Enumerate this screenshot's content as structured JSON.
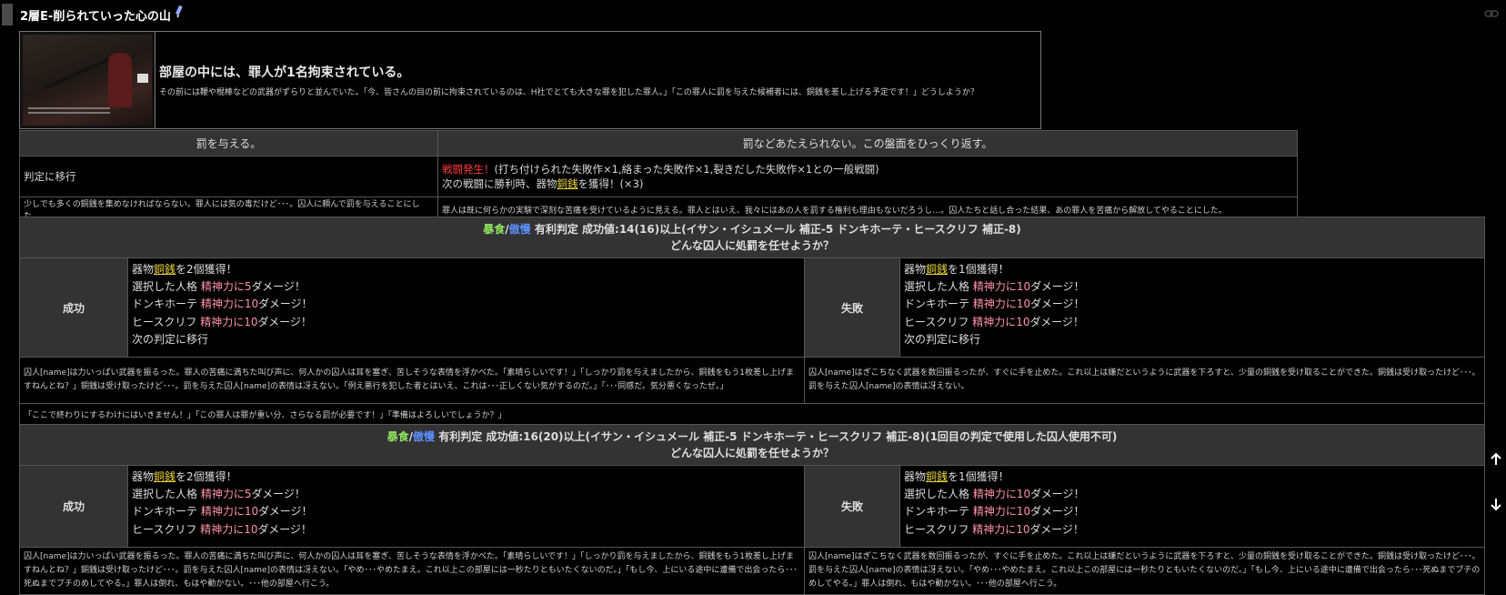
{
  "title": "2層E-削られていった心の山",
  "intro": {
    "heading": "部屋の中には、罪人が1名拘束されている。",
    "body": "その前には鞭や棍棒などの武器がずらりと並んでいた。「今、皆さんの目の前に拘束されているのは、H社でとても大きな罪を犯した罪人。」「この罪人に罰を与えた候補者には、銅銭を差し上げる予定です！」どうしようか？"
  },
  "choices": {
    "option_a": "罰を与える。",
    "option_b": "罰などあたえられない。この盤面をひっくり返す。",
    "a_effect": "判定に移行",
    "b_battle": "戦闘発生！",
    "b_battle_detail": "(打ち付けられた失敗作×1,絡まった失敗作×1,裂きだした失敗作×1との一般戦闘)",
    "b_reward_prefix": "次の戦闘に勝利時、器物",
    "b_reward_coin": "銅銭",
    "b_reward_suffix": "を獲得！(×3)",
    "a_desc": "少しでも多くの銅銭を集めなければならない。罪人には気の毒だけど･･･。囚人に頼んで罰を与えることにした。",
    "b_desc": "罪人は既に何らかの実験で深刻な苦痛を受けているように見える。罪人とはいえ、我々にはあの人を罰する権利も理由もないだろうし…。囚人たちと話し合った結果、あの罪人を苦痛から解放してやることにした。"
  },
  "judge1": {
    "stat1": "暴食",
    "slash": "/",
    "stat2": "傲慢",
    "condition": "有利判定 成功値:14(16)以上(イサン・イシュメール 補正-5 ドンキホーテ・ヒースクリフ 補正-8)",
    "question": "どんな囚人に処罰を任せようか？",
    "success_label": "成功",
    "fail_label": "失敗",
    "success": {
      "l1_a": "器物",
      "l1_coin": "銅銭",
      "l1_b": "を2個獲得！",
      "l2_name": "選択した人格 ",
      "l2_dmg": "精神力に5",
      "l2_tail": "ダメージ！",
      "l3_name": "ドンキホーテ ",
      "l3_dmg": "精神力に10",
      "l3_tail": "ダメージ！",
      "l4_name": "ヒースクリフ ",
      "l4_dmg": "精神力に10",
      "l4_tail": "ダメージ！",
      "l5": "次の判定に移行"
    },
    "fail": {
      "l1_a": "器物",
      "l1_coin": "銅銭",
      "l1_b": "を1個獲得！",
      "l2_name": "選択した人格 ",
      "l2_dmg": "精神力に10",
      "l2_tail": "ダメージ！",
      "l3_name": "ドンキホーテ ",
      "l3_dmg": "精神力に10",
      "l3_tail": "ダメージ！",
      "l4_name": "ヒースクリフ ",
      "l4_dmg": "精神力に10",
      "l4_tail": "ダメージ！",
      "l5": "次の判定に移行"
    },
    "success_desc": "囚人[name]は力いっぱい武器を振るった。罪人の苦痛に満ちた叫び声に、何人かの囚人は耳を塞ぎ、苦しそうな表情を浮かべた。「素晴らしいです！」「しっかり罰を与えましたから、銅銭をもう1枚差し上げますねんとね？」銅銭は受け取ったけど･･･。罰を与えた囚人[name]の表情は冴えない。「例え悪行を犯した者とはいえ、これは･･･正しくない気がするのだ。」「･･･同感だ。気分悪くなったぜ。」",
    "fail_desc": "囚人[name]はぎこちなく武器を数回振るったが、すぐに手を止めた。これ以上は嫌だというように武器を下ろすと、少量の銅銭を受け取ることができた。銅銭は受け取ったけど･･･。罰を与えた囚人[name]の表情は冴えない。",
    "quote": "「ここで終わりにするわけにはいきません！」「この罪人は罪が重い分、さらなる罰が必要です！」「準備はよろしいでしょうか？」"
  },
  "judge2": {
    "stat1": "暴食",
    "slash": "/",
    "stat2": "傲慢",
    "condition": "有利判定 成功値:16(20)以上(イサン・イシュメール 補正-5 ドンキホーテ・ヒースクリフ 補正-8)(1回目の判定で使用した囚人使用不可)",
    "question": "どんな囚人に処罰を任せようか？",
    "success_label": "成功",
    "fail_label": "失敗",
    "success": {
      "l1_a": "器物",
      "l1_coin": "銅銭",
      "l1_b": "を2個獲得！",
      "l2_name": "選択した人格 ",
      "l2_dmg": "精神力に5",
      "l2_tail": "ダメージ！",
      "l3_name": "ドンキホーテ ",
      "l3_dmg": "精神力に10",
      "l3_tail": "ダメージ！",
      "l4_name": "ヒースクリフ ",
      "l4_dmg": "精神力に10",
      "l4_tail": "ダメージ！"
    },
    "fail": {
      "l1_a": "器物",
      "l1_coin": "銅銭",
      "l1_b": "を1個獲得！",
      "l2_name": "選択した人格 ",
      "l2_dmg": "精神力に10",
      "l2_tail": "ダメージ！",
      "l3_name": "ドンキホーテ ",
      "l3_dmg": "精神力に10",
      "l3_tail": "ダメージ！",
      "l4_name": "ヒースクリフ ",
      "l4_dmg": "精神力に10",
      "l4_tail": "ダメージ！"
    },
    "success_desc": "囚人[name]は力いっぱい武器を振るった。罪人の苦痛に満ちた叫び声に、何人かの囚人は耳を塞ぎ、苦しそうな表情を浮かべた。「素晴らしいです！」「しっかり罰を与えましたから、銅銭をもう1枚差し上げますねんとね？」銅銭は受け取ったけど･･･。罰を与えた囚人[name]の表情は冴えない。「やめ･･･やめたまえ。これ以上この部屋には一秒たりともいたくないのだ。」「もし今、上にいる途中に遭備で出会ったら･･･死ぬまでブチのめしてやる。」罪人は倒れ、もはや動かない。･･･他の部屋へ行こう。",
    "fail_desc": "囚人[name]はぎこちなく武器を数回振るったが、すぐに手を止めた。これ以上は嫌だというように武器を下ろすと、少量の銅銭を受け取ることができた。銅銭は受け取ったけど･･･。罰を与えた囚人[name]の表情は冴えない。「やめ･･･やめたまえ。これ以上この部屋には一秒たりともいたくないのだ。」「もし今、上にいる途中に遭備で出会ったら･･･死ぬまでブチのめしてやる。」罪人は倒れ、もはや動かない。･･･他の部屋へ行こう。"
  },
  "colors": {
    "background": "#000000",
    "header_cell": "#333333",
    "border": "#555555",
    "red": "#ff3b3b",
    "pink": "#ff93a7",
    "green": "#8fe060",
    "blue": "#5b8fff",
    "coin": "#e8d23a"
  },
  "icons": [
    "pencil-icon",
    "link-icon",
    "arrow-up-icon",
    "arrow-down-icon"
  ]
}
